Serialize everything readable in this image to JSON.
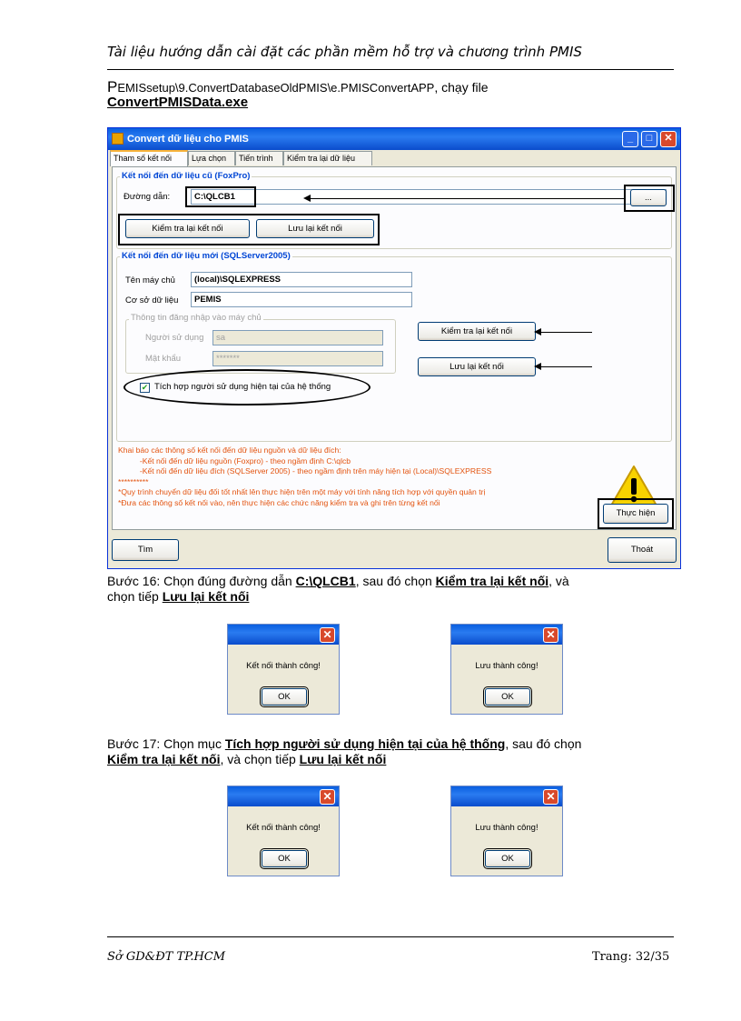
{
  "header": {
    "title": "Tài liệu hướng dẫn cài đặt các phần mềm hỗ trợ và chương trình PMIS"
  },
  "path": {
    "first_letter": "P",
    "rest": "EMISsetup\\9.ConvertDatabaseOldPMIS\\e.PMISConvertAPP",
    "suffix": ", chạy file",
    "exe": "ConvertPMISData.exe"
  },
  "window": {
    "title": "Convert dữ liệu cho PMIS",
    "tabs": [
      {
        "label": "Tham số kết nối",
        "active": true
      },
      {
        "label": "Lựa chọn"
      },
      {
        "label": "Tiến trình"
      },
      {
        "label": "Kiểm tra lại dữ liệu"
      }
    ],
    "foxpro": {
      "group_label": "Kết nối đến dữ liệu cũ (FoxPro)",
      "path_label": "Đường dẫn:",
      "path_value": "C:\\QLCB1",
      "browse_label": "...",
      "check_label": "Kiểm tra lại kết nối",
      "save_label": "Lưu lại kết nối"
    },
    "sql": {
      "group_label": "Kết nối đến dữ liệu mới (SQLServer2005)",
      "server_label": "Tên máy chủ",
      "server_value": "(local)\\SQLEXPRESS",
      "db_label": "Cơ sở dữ liệu",
      "db_value": "PEMIS",
      "login_group_label": "Thông tin đăng nhập vào máy chủ",
      "user_label": "Người sử dụng",
      "user_value": "sa",
      "pass_label": "Mật khẩu",
      "pass_value": "*******",
      "check_label": "Kiểm tra lại kết nối",
      "save_label": "Lưu lại kết nối",
      "integrated_label": "Tích hợp người sử dụng hiện tại của hệ thống",
      "integrated_checked": true
    },
    "notes": [
      "Khai báo các thông số kết nối đến dữ liệu nguồn và dữ liệu đích:",
      "          -Kết nối đến dữ liệu nguồn (Foxpro) - theo ngầm định C:\\qlcb",
      "          -Kết nối đến dữ liệu đích (SQLServer 2005) - theo ngầm định trên máy hiện tại (Local)\\SQLEXPRESS",
      "**********",
      "*Quy trình chuyển dữ liệu đối tốt nhất lên thực hiện trên một máy với tính năng tích hợp với quyền quản trị",
      "*Đưa các thông số kết nối vào, nên thực hiện các chức năng kiểm tra và ghi trên từng kết nối"
    ],
    "execute_label": "Thực hiện",
    "find_label": "Tìm",
    "exit_label": "Thoát",
    "colors": {
      "titlebar": "#0a5fe0",
      "group_title": "#0046d5",
      "notes": "#e3530f"
    }
  },
  "step16": {
    "prefix": "Bước 16: Chọn đúng đường dẫn ",
    "path": "C:\\QLCB1",
    "mid": ", sau đó chọn ",
    "check": "Kiểm tra lại kết nối",
    "mid2": ", và",
    "line2_prefix": "chọn tiếp ",
    "save": "Lưu lại kết nối"
  },
  "dialogs16": [
    {
      "message": "Kết nối thành công!",
      "ok": "OK"
    },
    {
      "message": "Lưu thành công!",
      "ok": "OK"
    }
  ],
  "step17": {
    "prefix": "Bước 17: Chọn mục ",
    "integrated": "Tích hợp người sử dụng hiện tại của hệ thống",
    "mid": ", sau đó chọn",
    "check": "Kiểm tra lại kết nối",
    "mid2": ", và chọn tiếp ",
    "save": "Lưu lại kết nối"
  },
  "dialogs17": [
    {
      "message": "Kết nối thành công!",
      "ok": "OK"
    },
    {
      "message": "Lưu thành công!",
      "ok": "OK"
    }
  ],
  "footer": {
    "left": "Sở GD&ĐT TP.HCM",
    "page_label": "Trang:",
    "page": "32/35"
  }
}
